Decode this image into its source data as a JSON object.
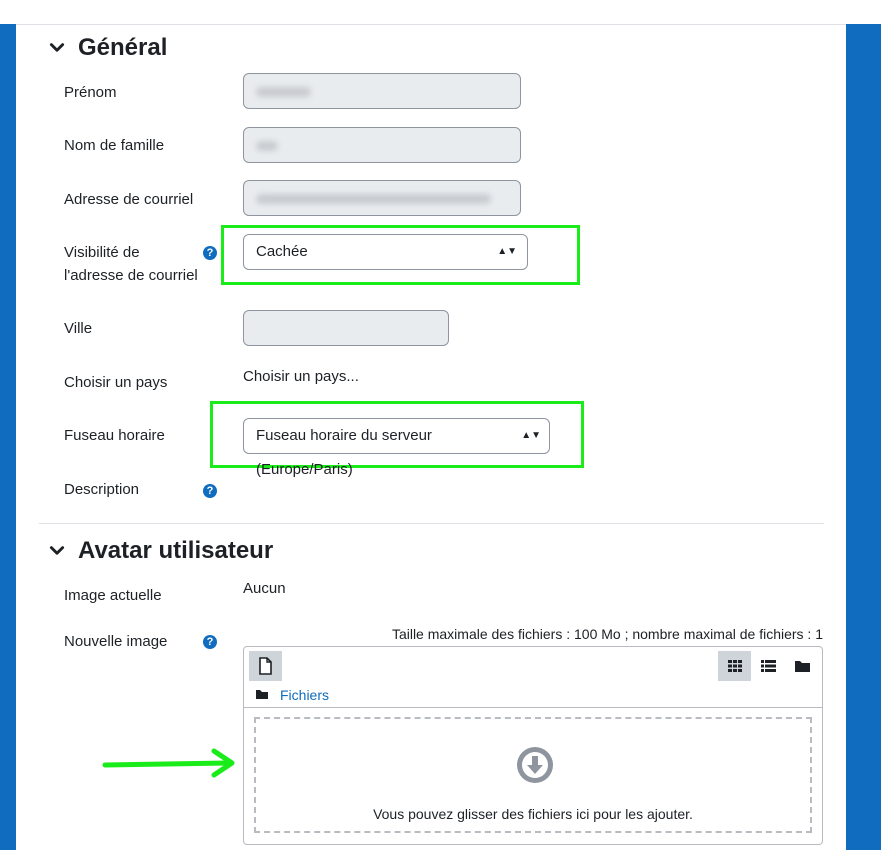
{
  "sections": {
    "general": {
      "title": "Général"
    },
    "avatar": {
      "title": "Avatar utilisateur"
    }
  },
  "fields": {
    "firstname": {
      "label": "Prénom"
    },
    "lastname": {
      "label": "Nom de famille"
    },
    "email": {
      "label": "Adresse de courriel"
    },
    "email_visibility": {
      "label_line1": "Visibilité de",
      "label_line2": "l'adresse de courriel",
      "value": "Cachée"
    },
    "city": {
      "label": "Ville"
    },
    "country": {
      "label": "Choisir un pays",
      "value": "Choisir un pays..."
    },
    "timezone": {
      "label": "Fuseau horaire",
      "value": "Fuseau horaire du serveur (Europe/Paris)"
    },
    "description": {
      "label": "Description"
    },
    "current_image": {
      "label": "Image actuelle",
      "value": "Aucun"
    },
    "new_image": {
      "label": "Nouvelle image"
    }
  },
  "filepicker": {
    "limits": "Taille maximale des fichiers : 100 Mo ; nombre maximal de fichiers : 1",
    "folder_link": "Fichiers",
    "drop_text": "Vous pouvez glisser des fichiers ici pour les ajouter."
  },
  "help_icon": "?",
  "colors": {
    "accent": "#0f6cbf",
    "highlight": "#19ec19"
  },
  "icons": [
    "chevron-down-icon",
    "help-icon",
    "file-icon",
    "grid-view-icon",
    "list-view-icon",
    "folder-icon",
    "download-arrow-icon",
    "arrow-right-icon"
  ]
}
